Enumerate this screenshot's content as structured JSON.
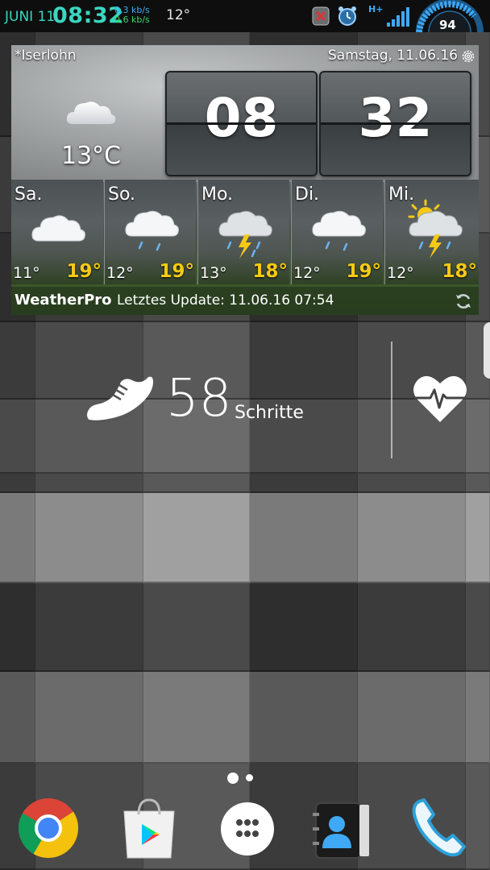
{
  "status_bar": {
    "date": "JUNI 11",
    "time": "08:32",
    "upload_speed": "0,3 kb/s",
    "download_speed": "0,6 kb/s",
    "temperature": "12°",
    "network_type": "H+",
    "battery_level": "94",
    "icons": [
      "app-notification-icon",
      "alarm-clock-icon",
      "signal-strength-icon"
    ]
  },
  "weather_widget": {
    "location": "*Iserlohn",
    "date": "Samstag, 11.06.16",
    "current_temp": "13°C",
    "current_condition_icon": "cloud-icon",
    "clock": {
      "hours": "08",
      "minutes": "32"
    },
    "forecast": [
      {
        "day": "Sa.",
        "low": "11°",
        "high": "19°",
        "icon": "cloud-icon"
      },
      {
        "day": "So.",
        "low": "12°",
        "high": "19°",
        "icon": "cloud-rain-icon"
      },
      {
        "day": "Mo.",
        "low": "13°",
        "high": "18°",
        "icon": "thunderstorm-icon"
      },
      {
        "day": "Di.",
        "low": "12°",
        "high": "19°",
        "icon": "cloud-rain-icon"
      },
      {
        "day": "Mi.",
        "low": "12°",
        "high": "18°",
        "icon": "sun-thunderstorm-icon"
      }
    ],
    "brand": "WeatherPro",
    "last_update": "Letztes Update: 11.06.16 07:54",
    "accent_color": "#f6c915"
  },
  "step_widget": {
    "count": "58",
    "label": "Schritte",
    "icons": [
      "shoe-icon",
      "heart-rate-icon"
    ]
  },
  "home_pages": {
    "count": 2,
    "current": 1
  },
  "dock": {
    "apps": [
      {
        "name": "Chrome",
        "icon": "chrome-icon"
      },
      {
        "name": "Play Store",
        "icon": "play-store-icon"
      },
      {
        "name": "App Drawer",
        "icon": "app-drawer-icon"
      },
      {
        "name": "Contacts",
        "icon": "contacts-icon"
      },
      {
        "name": "Phone",
        "icon": "phone-icon"
      }
    ]
  }
}
